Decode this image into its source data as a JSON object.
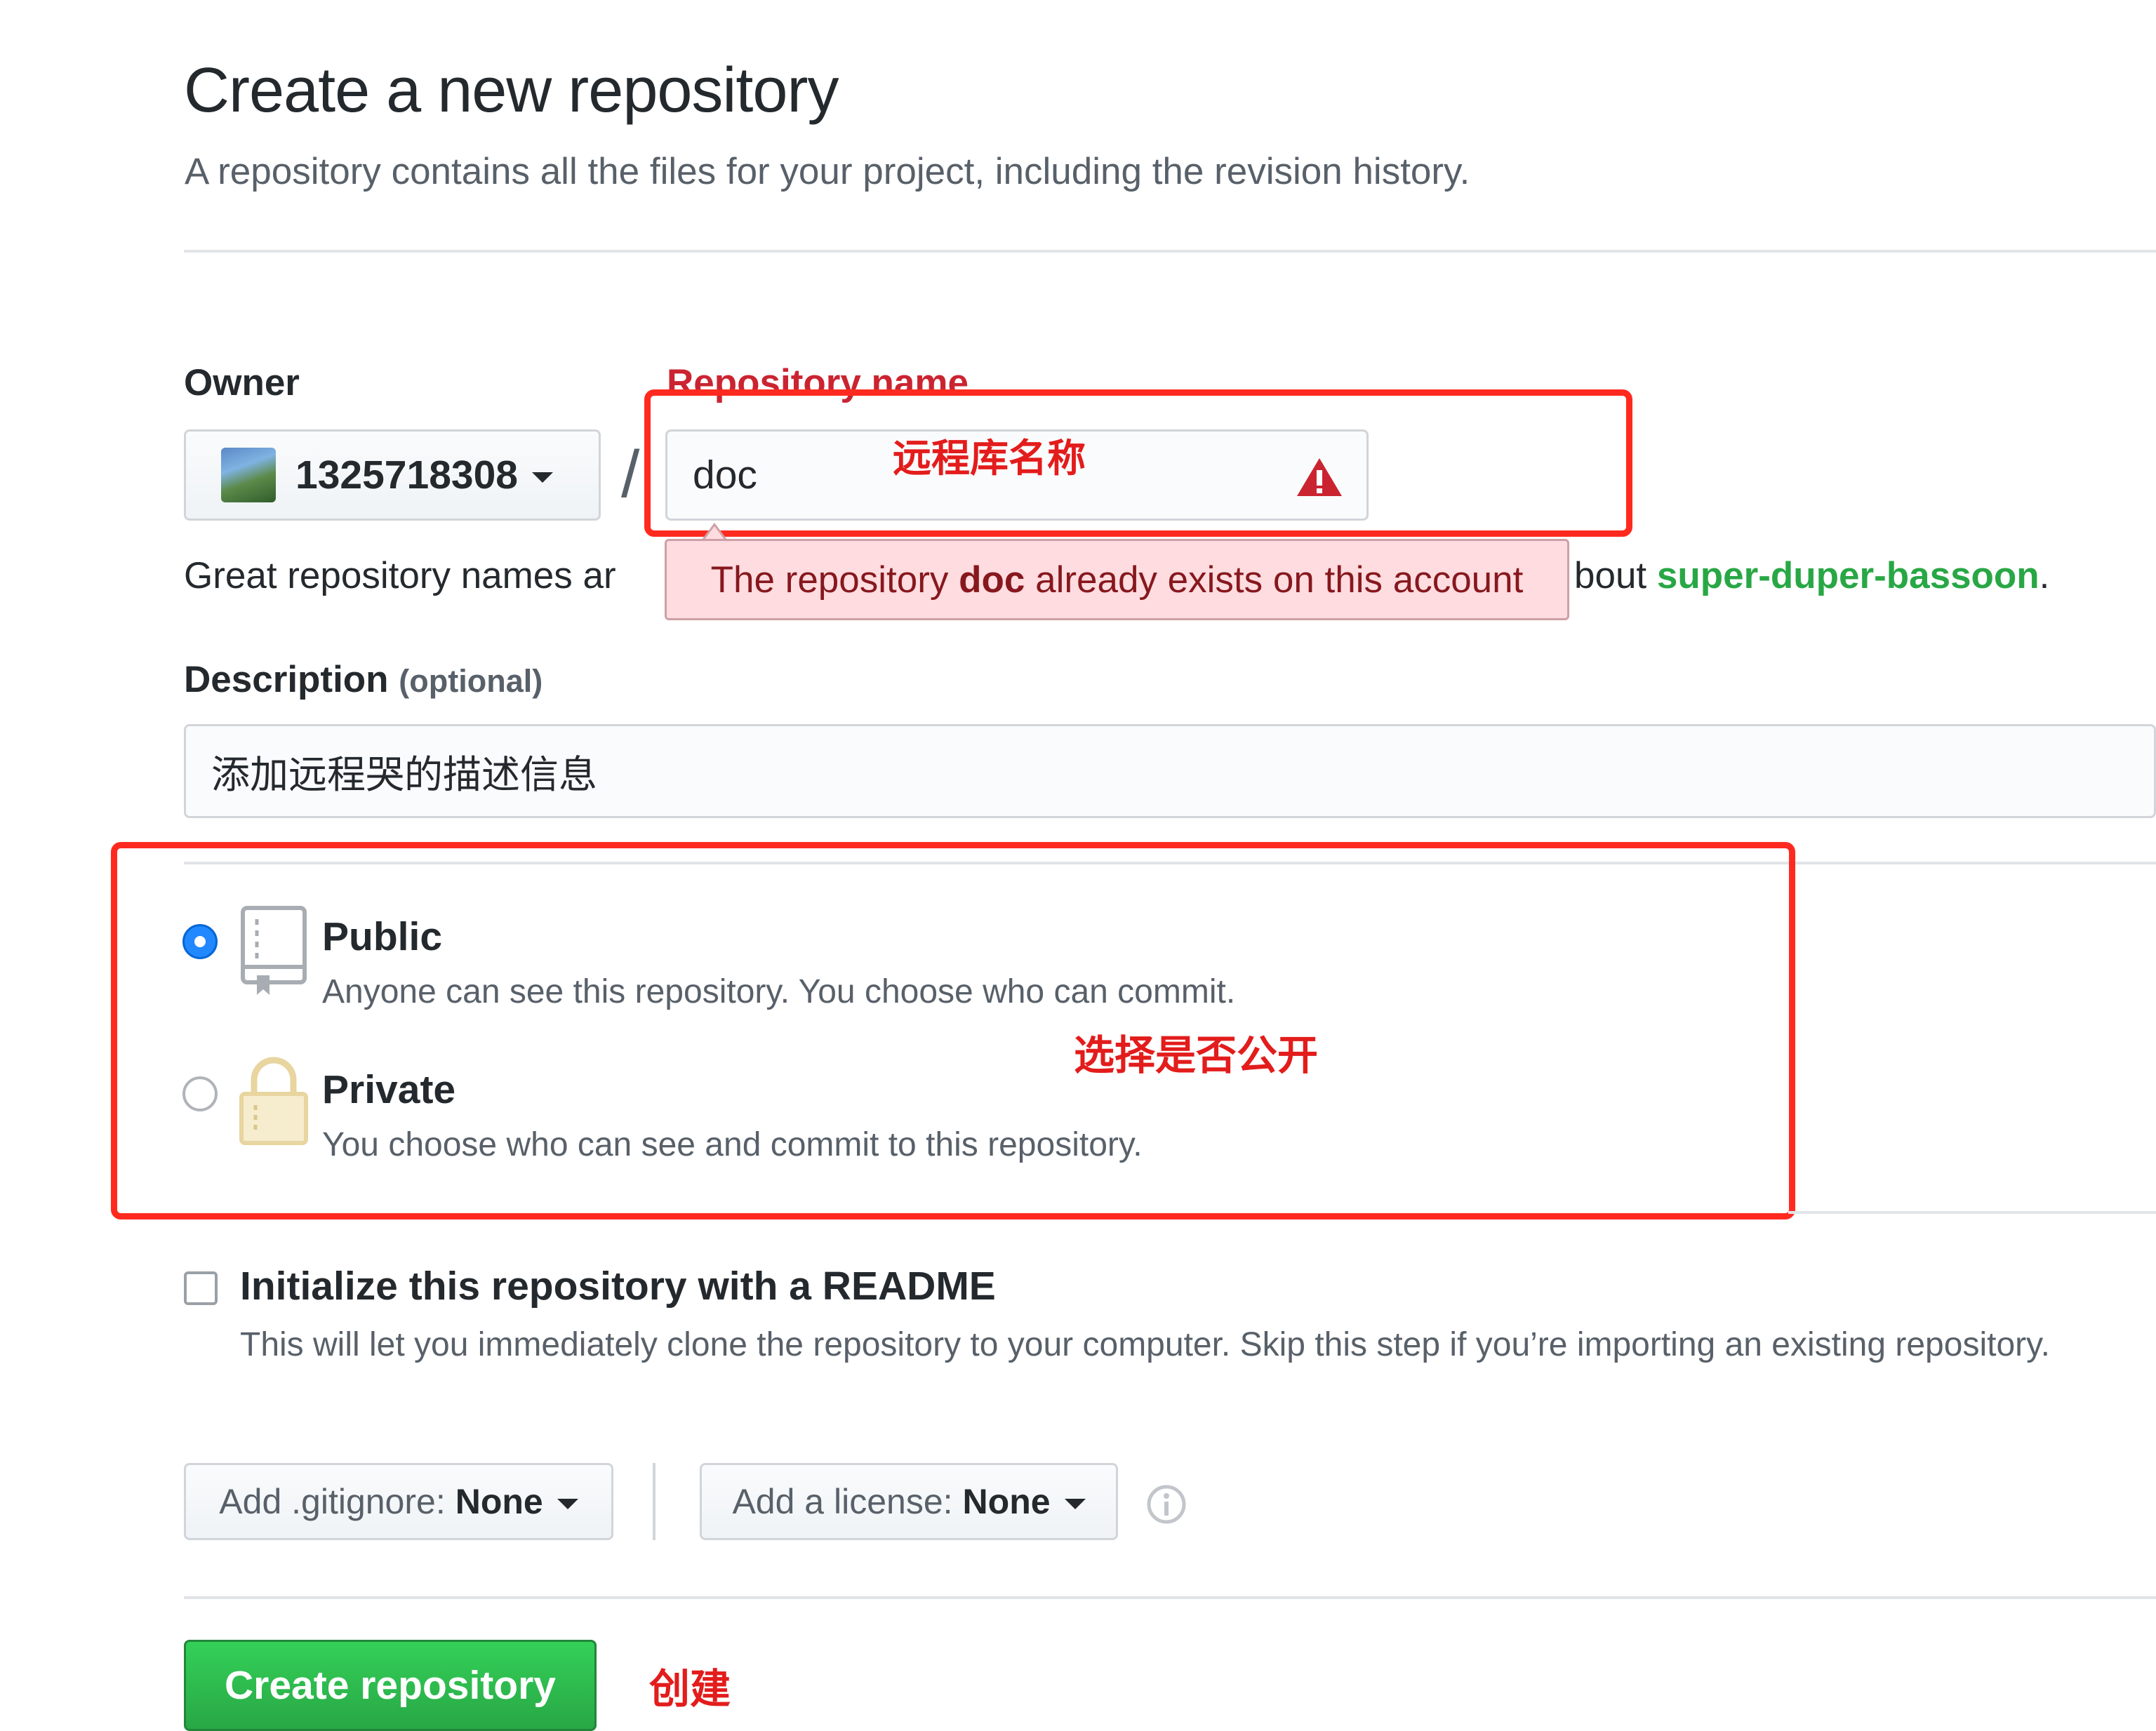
{
  "header": {
    "title": "Create a new repository",
    "subtitle": "A repository contains all the files for your project, including the revision history."
  },
  "owner": {
    "label": "Owner",
    "value": "1325718308"
  },
  "separator": "/",
  "repo_name": {
    "label": "Repository name",
    "value": "doc",
    "annotation": "远程库名称"
  },
  "hint": {
    "prefix": "Great repository names ar",
    "suffix": "bout ",
    "link": "super-duper-bassoon",
    "end": "."
  },
  "error": {
    "text_before": "The repository ",
    "name": "doc",
    "text_after": " already exists on this account"
  },
  "description": {
    "label": "Description",
    "optional": "(optional)",
    "value": "添加远程哭的描述信息"
  },
  "visibility": {
    "annotation": "选择是否公开",
    "public": {
      "title": "Public",
      "text": "Anyone can see this repository. You choose who can commit.",
      "selected": true
    },
    "private": {
      "title": "Private",
      "text": "You choose who can see and commit to this repository.",
      "selected": false
    }
  },
  "readme": {
    "title": "Initialize this repository with a README",
    "text": "This will let you immediately clone the repository to your computer. Skip this step if you’re importing an existing repository.",
    "checked": false
  },
  "gitignore": {
    "label": "Add .gitignore:",
    "value": "None"
  },
  "license": {
    "label": "Add a license:",
    "value": "None"
  },
  "submit": {
    "label": "Create repository",
    "annotation": "创建"
  },
  "colors": {
    "annotation_red": "#ff2a1f",
    "submit_green": "#28a745",
    "error_bg": "#ffdce0",
    "radio_blue": "#2188ff"
  },
  "icons": [
    "caret-down-icon",
    "warning-icon",
    "repo-book-icon",
    "lock-icon",
    "info-icon"
  ]
}
